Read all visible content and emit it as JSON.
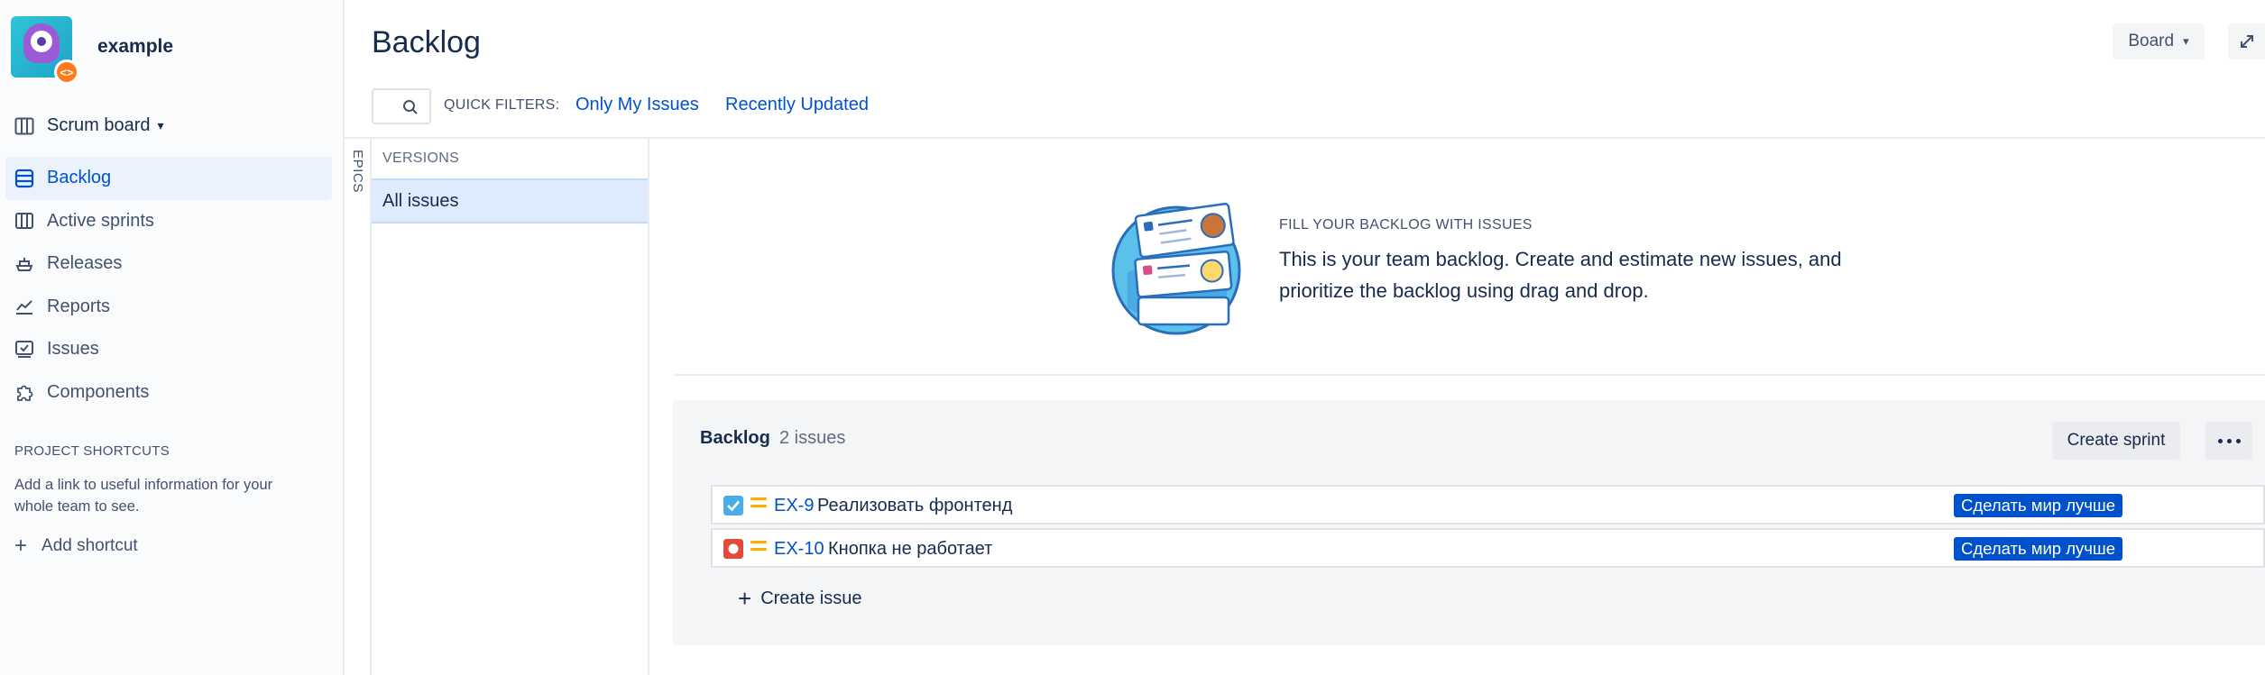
{
  "project": {
    "name": "example",
    "badge_icon": "code-icon"
  },
  "sidebar": {
    "board_switcher": "Scrum board",
    "items": [
      {
        "label": "Backlog",
        "icon": "backlog-icon",
        "active": true
      },
      {
        "label": "Active sprints",
        "icon": "board-columns-icon",
        "active": false
      },
      {
        "label": "Releases",
        "icon": "ship-icon",
        "active": false
      },
      {
        "label": "Reports",
        "icon": "chart-icon",
        "active": false
      },
      {
        "label": "Issues",
        "icon": "issues-icon",
        "active": false
      },
      {
        "label": "Components",
        "icon": "puzzle-icon",
        "active": false
      }
    ],
    "shortcuts": {
      "title": "PROJECT SHORTCUTS",
      "text": "Add a link to useful information for your whole team to see.",
      "add_label": "Add shortcut"
    }
  },
  "header": {
    "title": "Backlog",
    "board_button": "Board",
    "quick_filters_label": "QUICK FILTERS:",
    "quick_filters": [
      "Only My Issues",
      "Recently Updated"
    ]
  },
  "epics_label": "EPICS",
  "versions": {
    "title": "VERSIONS",
    "all_label": "All issues"
  },
  "empty_state": {
    "title": "FILL YOUR BACKLOG WITH ISSUES",
    "text": "This is your team backlog. Create and estimate new issues, and prioritize the backlog using drag and drop."
  },
  "backlog": {
    "title": "Backlog",
    "count": "2 issues",
    "create_sprint": "Create sprint",
    "create_issue": "Create issue",
    "issues": [
      {
        "type": "task",
        "type_color": "#4bade8",
        "priority": "medium",
        "key": "EX-9",
        "summary": "Реализовать фронтенд",
        "epic": "Сделать мир лучше"
      },
      {
        "type": "bug",
        "type_color": "#e5493a",
        "priority": "medium",
        "key": "EX-10",
        "summary": "Кнопка не работает",
        "epic": "Сделать мир лучше"
      }
    ]
  },
  "colors": {
    "accent": "#0052cc",
    "epic_badge": "#0052cc",
    "priority_medium": "#ffab00"
  }
}
